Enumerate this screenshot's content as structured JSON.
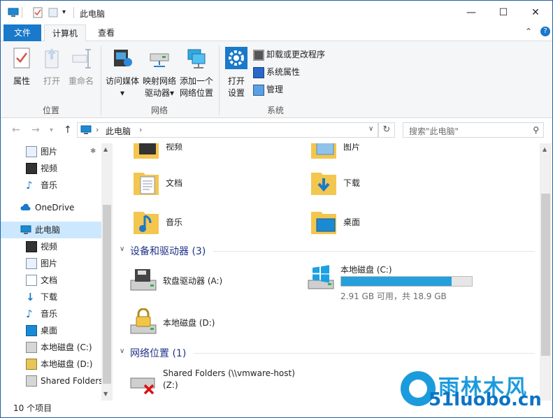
{
  "window": {
    "title": "此电脑",
    "controls": {
      "minimize": "—",
      "maximize": "☐",
      "close": "✕"
    }
  },
  "ribbon_tabs": {
    "file": "文件",
    "computer": "计算机",
    "view": "查看",
    "expand": "⌃",
    "help": "?"
  },
  "ribbon": {
    "location": {
      "label": "位置",
      "properties": "属性",
      "open": "打开",
      "rename": "重命名"
    },
    "network": {
      "label": "网络",
      "media_line1": "访问媒体",
      "map_line1": "映射网络",
      "map_line2": "驱动器",
      "add_line1": "添加一个",
      "add_line2": "网络位置"
    },
    "system": {
      "label": "系统",
      "open_line1": "打开",
      "open_line2": "设置",
      "uninstall": "卸载或更改程序",
      "sys_props": "系统属性",
      "manage": "管理"
    }
  },
  "address": {
    "path": "此电脑",
    "search_placeholder": "搜索\"此电脑\""
  },
  "sidebar": {
    "items": [
      {
        "label": "图片"
      },
      {
        "label": "视频"
      },
      {
        "label": "音乐"
      },
      {
        "label": "OneDrive"
      },
      {
        "label": "此电脑"
      },
      {
        "label": "视频"
      },
      {
        "label": "图片"
      },
      {
        "label": "文档"
      },
      {
        "label": "下载"
      },
      {
        "label": "音乐"
      },
      {
        "label": "桌面"
      },
      {
        "label": "本地磁盘 (C:)"
      },
      {
        "label": "本地磁盘 (D:)"
      },
      {
        "label": "Shared Folders"
      }
    ]
  },
  "folders": {
    "videos": "视频",
    "pictures": "图片",
    "documents": "文档",
    "downloads": "下载",
    "music": "音乐",
    "desktop": "桌面"
  },
  "devices": {
    "header": "设备和驱动器 (3)",
    "floppy": "软盘驱动器 (A:)",
    "c_name": "本地磁盘 (C:)",
    "c_usage": 0.846,
    "c_detail": "2.91 GB 可用，共 18.9 GB",
    "d_name": "本地磁盘 (D:)"
  },
  "network_locations": {
    "header": "网络位置 (1)",
    "shared_line1": "Shared Folders (\\\\vmware-host)",
    "shared_line2": "(Z:)"
  },
  "status": {
    "count": "10 个项目"
  },
  "watermark": {
    "brand": "雨林木风",
    "site": "51luobo.cn"
  },
  "colors": {
    "accent": "#1979ca",
    "selection": "#cce8ff",
    "progress": "#26a0da",
    "section_header": "#1e3287"
  }
}
